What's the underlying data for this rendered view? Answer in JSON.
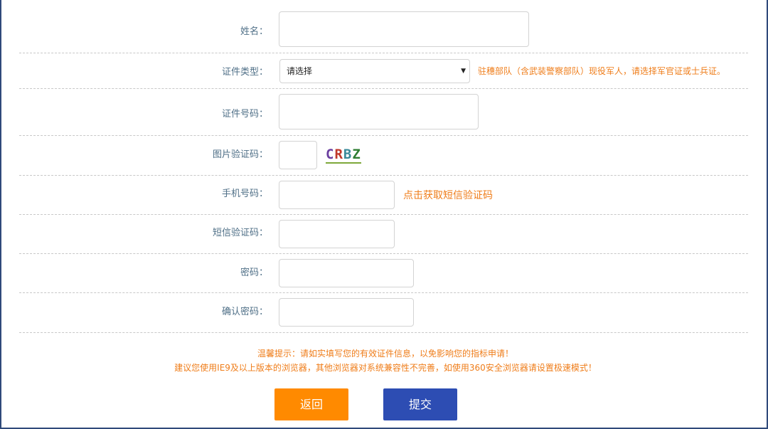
{
  "form": {
    "name_label": "姓名：",
    "id_type_label": "证件类型：",
    "id_type_selected": "请选择",
    "id_type_note": "驻穗部队（含武装警察部队）现役军人，请选择军官证或士兵证。",
    "id_number_label": "证件号码：",
    "captcha_label": "图片验证码：",
    "captcha_text": [
      "C",
      "R",
      "B",
      "Z"
    ],
    "phone_label": "手机号码：",
    "sms_link": "点击获取短信验证码",
    "sms_code_label": "短信验证码：",
    "password_label": "密码：",
    "confirm_password_label": "确认密码："
  },
  "tips": {
    "line1": "温馨提示：请如实填写您的有效证件信息，以免影响您的指标申请！",
    "line2": "建议您使用IE9及以上版本的浏览器，其他浏览器对系统兼容性不完善，如使用360安全浏览器请设置极速模式！"
  },
  "buttons": {
    "back": "返回",
    "submit": "提交"
  },
  "colors": {
    "accent_orange": "#ef7d1a",
    "back_button": "#ff8a00",
    "submit_button": "#2d4db3",
    "label_text": "#4f6f87"
  }
}
